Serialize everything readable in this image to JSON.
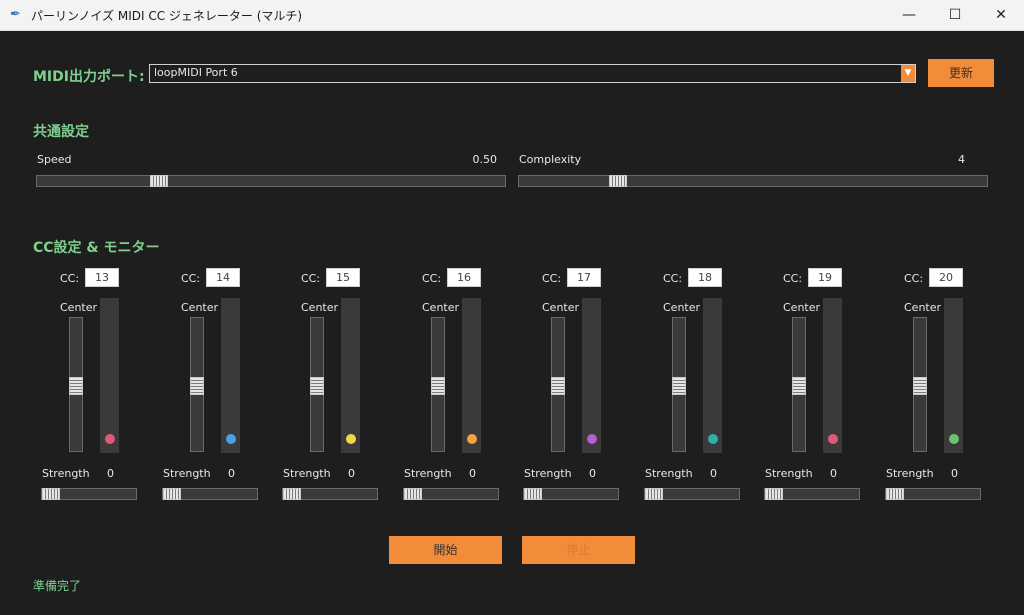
{
  "window": {
    "title": "パーリンノイズ MIDI CC ジェネレーター (マルチ)",
    "icon": "feather-icon",
    "buttons": {
      "minimize": "—",
      "maximize": "☐",
      "close": "✕"
    }
  },
  "port": {
    "label": "MIDI出力ポート:",
    "selected": "loopMIDI Port 6",
    "refresh_label": "更新"
  },
  "common": {
    "title": "共通設定",
    "speed": {
      "label": "Speed",
      "value": "0.50",
      "level": 0.25
    },
    "complexity": {
      "label": "Complexity",
      "value": "4",
      "level": 0.2
    }
  },
  "cc_section": {
    "title": "CC設定 & モニター",
    "cc_label": "CC:",
    "center_label": "Center",
    "strength_label": "Strength",
    "channels": [
      {
        "cc": "13",
        "strength": "0",
        "center": 0.5,
        "color": "#e05a77"
      },
      {
        "cc": "14",
        "strength": "0",
        "center": 0.5,
        "color": "#4aa0e8"
      },
      {
        "cc": "15",
        "strength": "0",
        "center": 0.5,
        "color": "#f5d64a"
      },
      {
        "cc": "16",
        "strength": "0",
        "center": 0.5,
        "color": "#f2a33a"
      },
      {
        "cc": "17",
        "strength": "0",
        "center": 0.5,
        "color": "#b45ed0"
      },
      {
        "cc": "18",
        "strength": "0",
        "center": 0.5,
        "color": "#2bb3a9"
      },
      {
        "cc": "19",
        "strength": "0",
        "center": 0.5,
        "color": "#e05a77"
      },
      {
        "cc": "20",
        "strength": "0",
        "center": 0.5,
        "color": "#6ac46e"
      }
    ]
  },
  "controls": {
    "start_label": "開始",
    "stop_label": "停止"
  },
  "status": "準備完了",
  "colors": {
    "accent": "#f28c38",
    "section": "#7fcf8f",
    "background": "#1e1e1e"
  }
}
